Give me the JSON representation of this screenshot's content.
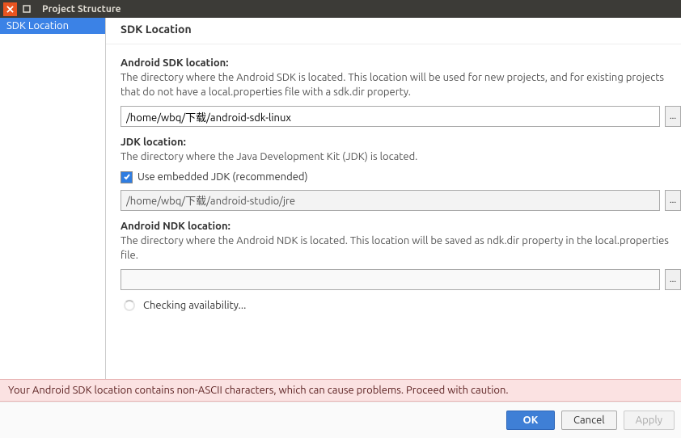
{
  "window": {
    "title": "Project Structure"
  },
  "sidebar": {
    "items": [
      {
        "label": "SDK Location",
        "selected": true
      }
    ]
  },
  "main": {
    "header": "SDK Location",
    "sdk": {
      "title": "Android SDK location:",
      "desc": "The directory where the Android SDK is located. This location will be used for new projects, and for existing projects that do not have a local.properties file with a sdk.dir property.",
      "value": "/home/wbq/下载/android-sdk-linux",
      "browse": "..."
    },
    "jdk": {
      "title": "JDK location:",
      "desc": "The directory where the Java Development Kit (JDK) is located.",
      "embedded_label": "Use embedded JDK (recommended)",
      "embedded_checked": true,
      "value": "/home/wbq/下载/android-studio/jre",
      "browse": "..."
    },
    "ndk": {
      "title": "Android NDK location:",
      "desc": "The directory where the Android NDK is located. This location will be saved as ndk.dir property in the local.properties file.",
      "value": "",
      "browse": "..."
    },
    "status": "Checking availability..."
  },
  "warning": "Your Android SDK location contains non-ASCII characters, which can cause problems. Proceed with caution.",
  "buttons": {
    "ok": "OK",
    "cancel": "Cancel",
    "apply": "Apply"
  }
}
